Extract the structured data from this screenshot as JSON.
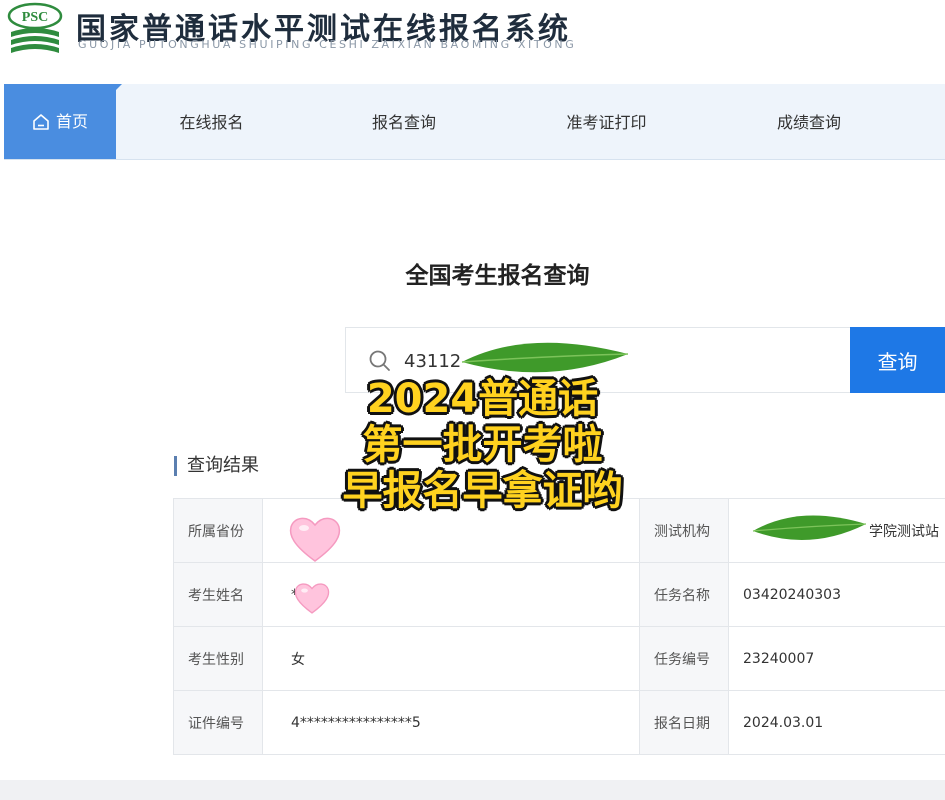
{
  "header": {
    "logo_text": "PSC",
    "title": "国家普通话水平测试在线报名系统",
    "subtitle": "GUOJIA PUTONGHUA SHUIPING CESHI ZAIXIAN BAOMING XITONG"
  },
  "nav": {
    "items": [
      {
        "label": "首页"
      },
      {
        "label": "在线报名"
      },
      {
        "label": "报名查询"
      },
      {
        "label": "准考证打印"
      },
      {
        "label": "成绩查询"
      }
    ]
  },
  "main": {
    "title": "全国考生报名查询",
    "search_value": "43112               5",
    "search_button": "查询",
    "section_heading": "查询结果"
  },
  "result": {
    "rows": [
      {
        "label1": "所属省份",
        "value1": "",
        "label2": "测试机构",
        "value2": "学院测试站"
      },
      {
        "label1": "考生姓名",
        "value1": "*",
        "label2": "任务名称",
        "value2": "03420240303"
      },
      {
        "label1": "考生性别",
        "value1": "女",
        "label2": "任务编号",
        "value2": "23240007"
      },
      {
        "label1": "证件编号",
        "value1": "4****************5",
        "label2": "报名日期",
        "value2": "2024.03.01"
      }
    ]
  },
  "overlay": {
    "line1": "2024普通话",
    "line2": "第一批开考啦",
    "line3": "早报名早拿证哟"
  },
  "colors": {
    "nav_active": "#4a8de0",
    "search_button": "#1e78e6",
    "caption": "#ffd21f"
  }
}
